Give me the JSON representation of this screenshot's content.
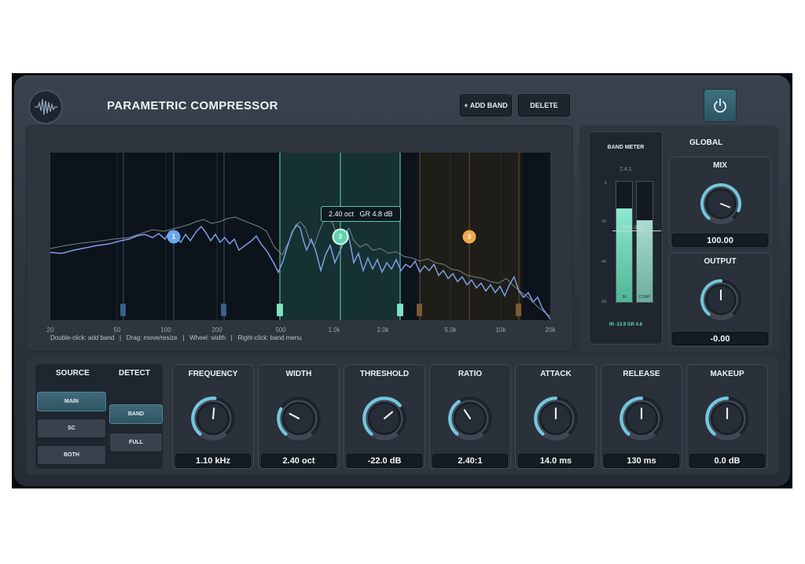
{
  "header": {
    "title": "PARAMETRIC COMPRESSOR",
    "add_band_label": "+ ADD BAND",
    "delete_label": "DELETE",
    "logo_icon": "waveform-icon",
    "power_icon": "power-icon"
  },
  "graph": {
    "x_ticks": [
      "20",
      "50",
      "100",
      "200",
      "500",
      "1.0k",
      "2.0k",
      "5.0k",
      "10k",
      "20k"
    ],
    "hint": "Double-click: add band   |   Drag: move/resize   |   Wheel: width   |   Right-click: band menu",
    "tooltip": "2.40 oct   GR 4.8 dB",
    "bands": [
      {
        "label": "1",
        "color": "#6aa7ea"
      },
      {
        "label": "2",
        "color": "#5fd3ae"
      },
      {
        "label": "3",
        "color": "#f0a94e"
      }
    ]
  },
  "band_meter": {
    "title": "BAND METER",
    "ratio": "2.4:1",
    "scale": [
      "0",
      "-20",
      "-40",
      "-60"
    ],
    "bar_in_label": "IN",
    "bar_comp_label": "COMP",
    "threshold_label": "THR -22.0",
    "readout": "IN -13.9   GR 4.8",
    "in_level": 0.78,
    "comp_level": 0.68
  },
  "global": {
    "title": "GLOBAL",
    "mix": {
      "label": "MIX",
      "value": "100.00",
      "position": 0.9
    },
    "output": {
      "label": "OUTPUT",
      "value": "-0.00",
      "position": 0.5
    }
  },
  "source": {
    "title": "SOURCE",
    "options": [
      "MAIN",
      "SC",
      "BOTH"
    ],
    "selected": "MAIN"
  },
  "detect": {
    "title": "DETECT",
    "options": [
      "BAND",
      "FULL"
    ],
    "selected": "BAND"
  },
  "params": [
    {
      "label": "FREQUENCY",
      "value": "1.10 kHz",
      "position": 0.52
    },
    {
      "label": "WIDTH",
      "value": "2.40 oct",
      "position": 0.28
    },
    {
      "label": "THRESHOLD",
      "value": "-22.0 dB",
      "position": 0.68
    },
    {
      "label": "RATIO",
      "value": "2.40:1",
      "position": 0.38
    },
    {
      "label": "ATTACK",
      "value": "14.0 ms",
      "position": 0.5
    },
    {
      "label": "RELEASE",
      "value": "130 ms",
      "position": 0.5
    },
    {
      "label": "MAKEUP",
      "value": "0.0 dB",
      "position": 0.5
    }
  ]
}
